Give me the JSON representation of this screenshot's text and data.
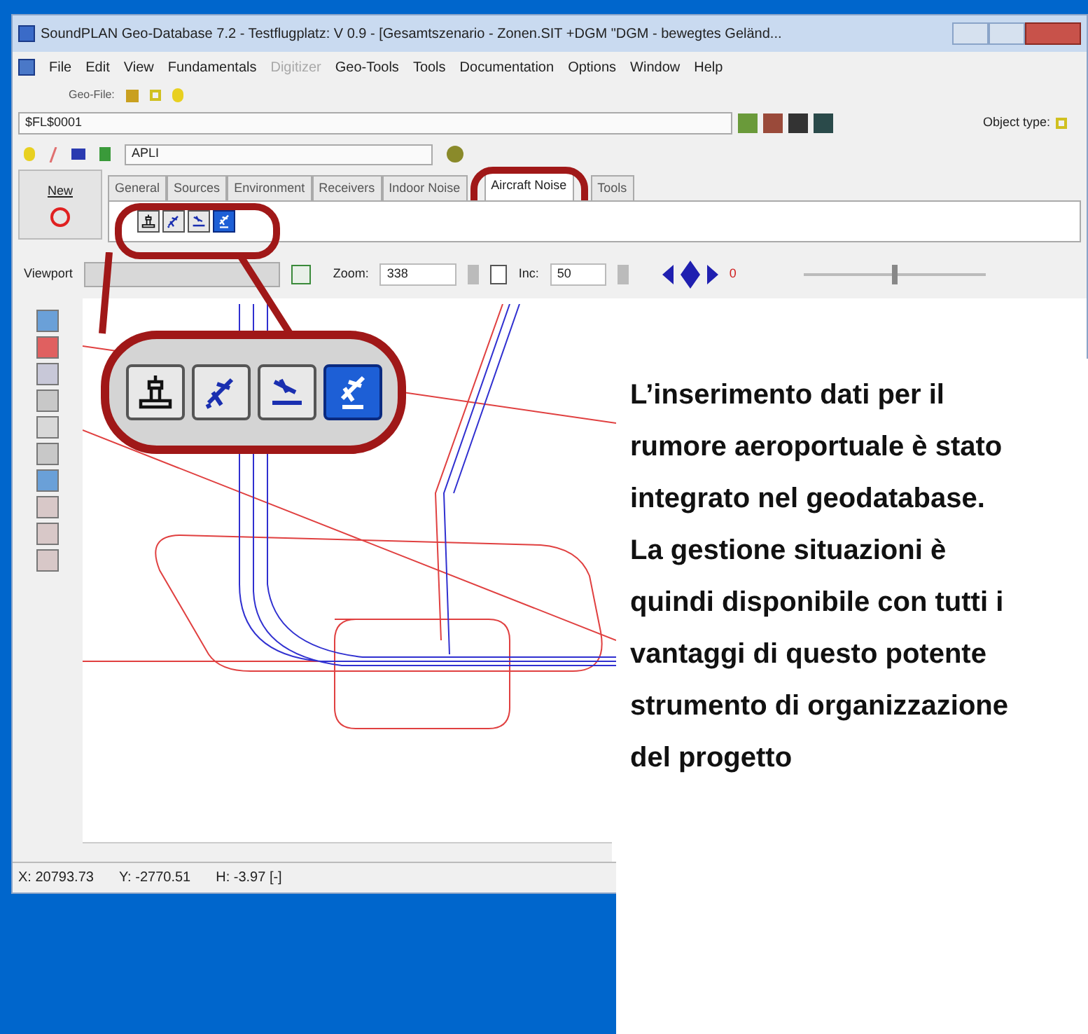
{
  "window": {
    "title": "SoundPLAN Geo-Database 7.2 - Testflugplatz: V 0.9 - [Gesamtszenario - Zonen.SIT +DGM \"DGM - bewegtes Geländ..."
  },
  "menu": [
    {
      "label": "File",
      "disabled": false
    },
    {
      "label": "Edit",
      "disabled": false
    },
    {
      "label": "View",
      "disabled": false
    },
    {
      "label": "Fundamentals",
      "disabled": false
    },
    {
      "label": "Digitizer",
      "disabled": true
    },
    {
      "label": "Geo-Tools",
      "disabled": false
    },
    {
      "label": "Tools",
      "disabled": false
    },
    {
      "label": "Documentation",
      "disabled": false
    },
    {
      "label": "Options",
      "disabled": false
    },
    {
      "label": "Window",
      "disabled": false
    },
    {
      "label": "Help",
      "disabled": false
    }
  ],
  "geo_file_label": "Geo-File:",
  "file_field": {
    "value": "$FL$0001"
  },
  "object_type_label": "Object type:",
  "layer_field": {
    "value": "APLI"
  },
  "new_button": "New",
  "tabs": [
    {
      "label": "General",
      "selected": false
    },
    {
      "label": "Sources",
      "selected": false
    },
    {
      "label": "Environment",
      "selected": false
    },
    {
      "label": "Receivers",
      "selected": false
    },
    {
      "label": "Indoor Noise",
      "selected": false
    },
    {
      "label": "Aircraft Noise",
      "selected": true
    },
    {
      "label": "Tools",
      "selected": false
    }
  ],
  "aircraft_tools": [
    {
      "kind": "tower",
      "selected": false
    },
    {
      "kind": "plane",
      "selected": false
    },
    {
      "kind": "landing",
      "selected": false
    },
    {
      "kind": "apli",
      "selected": true
    }
  ],
  "viewport": {
    "label": "Viewport"
  },
  "zoom": {
    "label": "Zoom:",
    "value": "338"
  },
  "inc": {
    "label": "Inc:",
    "value": "50"
  },
  "rotation": "0",
  "slider": {
    "level": 0.5
  },
  "status_bar": [
    "X: 20793.73",
    "Y: -2770.51",
    "H: -3.97 [-]"
  ],
  "callout": "L’inserimento dati per il rumore aeroportuale è stato integrato nel geodatabase. La gestione situazioni è quindi disponibile con tutti i vantaggi di questo potente strumento di organizzazione del progetto"
}
